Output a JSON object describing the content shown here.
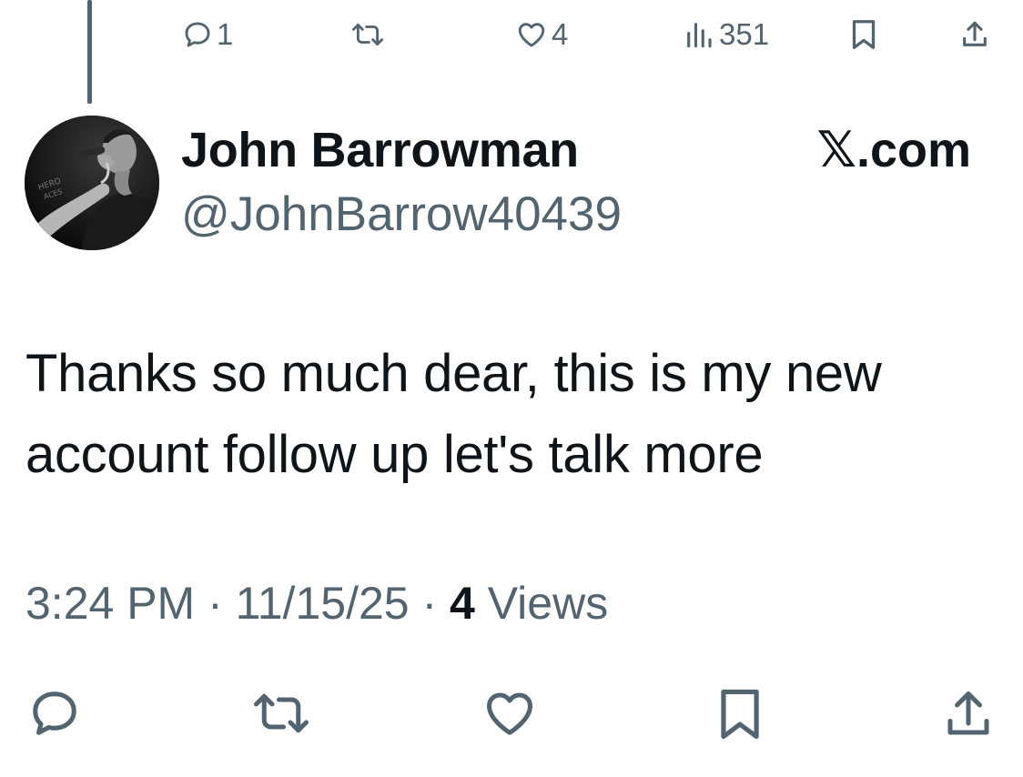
{
  "top_actions": {
    "reply_count": "1",
    "like_count": "4",
    "view_count": "351"
  },
  "tweet": {
    "display_name": "John Barrowman",
    "handle": "@JohnBarrow40439",
    "site": "𝕏.com",
    "text": "Thanks so much dear, this is my new account follow up let's talk more",
    "time": "3:24 PM",
    "separator_1": " · ",
    "date": "11/15/25",
    "separator_2": " · ",
    "views_count": "4",
    "views_label": " Views"
  },
  "icons": {
    "top": [
      "reply-icon",
      "retweet-icon",
      "like-icon",
      "views-icon",
      "bookmark-icon",
      "share-icon"
    ],
    "bottom": [
      "reply-icon",
      "retweet-icon",
      "like-icon",
      "bookmark-icon",
      "share-icon"
    ]
  },
  "colors": {
    "primary_text": "#0f1419",
    "secondary_text": "#536471",
    "background": "#ffffff"
  }
}
